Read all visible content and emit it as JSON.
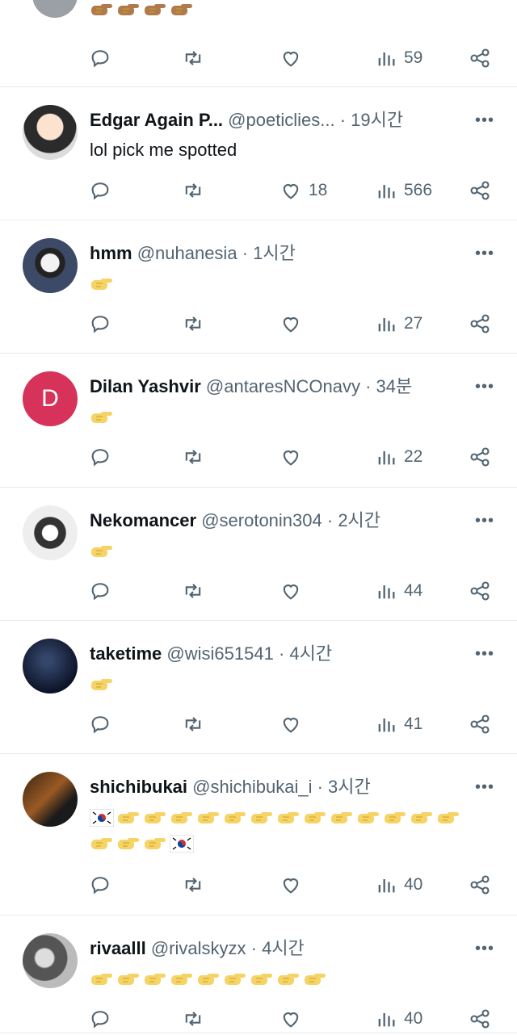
{
  "tweets": [
    {
      "id": "t0",
      "name": "",
      "handle": "",
      "time": "",
      "text": "",
      "emoji_count": 4,
      "likes": "",
      "views": "59"
    },
    {
      "id": "t1",
      "name": "Edgar Again P...",
      "handle": "@poeticlies...",
      "time": "· 19시간",
      "text": "lol pick me spotted",
      "emoji_count": 0,
      "likes": "18",
      "views": "566"
    },
    {
      "id": "t2",
      "name": "hmm",
      "handle": "@nuhanesia",
      "time": "· 1시간",
      "text": "",
      "emoji_count": 1,
      "likes": "",
      "views": "27"
    },
    {
      "id": "t3",
      "name": "Dilan Yashvir",
      "handle": "@antaresNCOnavy",
      "time": "· 34분",
      "text": "",
      "emoji_count": 1,
      "likes": "",
      "views": "22",
      "avatar_letter": "D"
    },
    {
      "id": "t4",
      "name": "Nekomancer",
      "handle": "@serotonin304",
      "time": "· 2시간",
      "text": "",
      "emoji_count": 1,
      "likes": "",
      "views": "44"
    },
    {
      "id": "t5",
      "name": "taketime",
      "handle": "@wisi651541",
      "time": "· 4시간",
      "text": "",
      "emoji_count": 1,
      "likes": "",
      "views": "41"
    },
    {
      "id": "t6",
      "name": "shichibukai",
      "handle": "@shichibukai_i",
      "time": "· 3시간",
      "text": "",
      "emoji_count": 16,
      "likes": "",
      "views": "40"
    },
    {
      "id": "t7",
      "name": "rivaalll",
      "handle": "@rivalskyzx",
      "time": "· 4시간",
      "text": "",
      "emoji_count": 9,
      "likes": "",
      "views": "40"
    }
  ],
  "more_glyph": "•••",
  "colors": {
    "text": "#0f1419",
    "muted": "#536471",
    "divider": "#e7e9ea",
    "emoji": "#f6d365",
    "dilan_avatar": "#d6325a"
  },
  "icons": [
    "reply-icon",
    "retweet-icon",
    "like-icon",
    "views-icon",
    "share-icon"
  ]
}
